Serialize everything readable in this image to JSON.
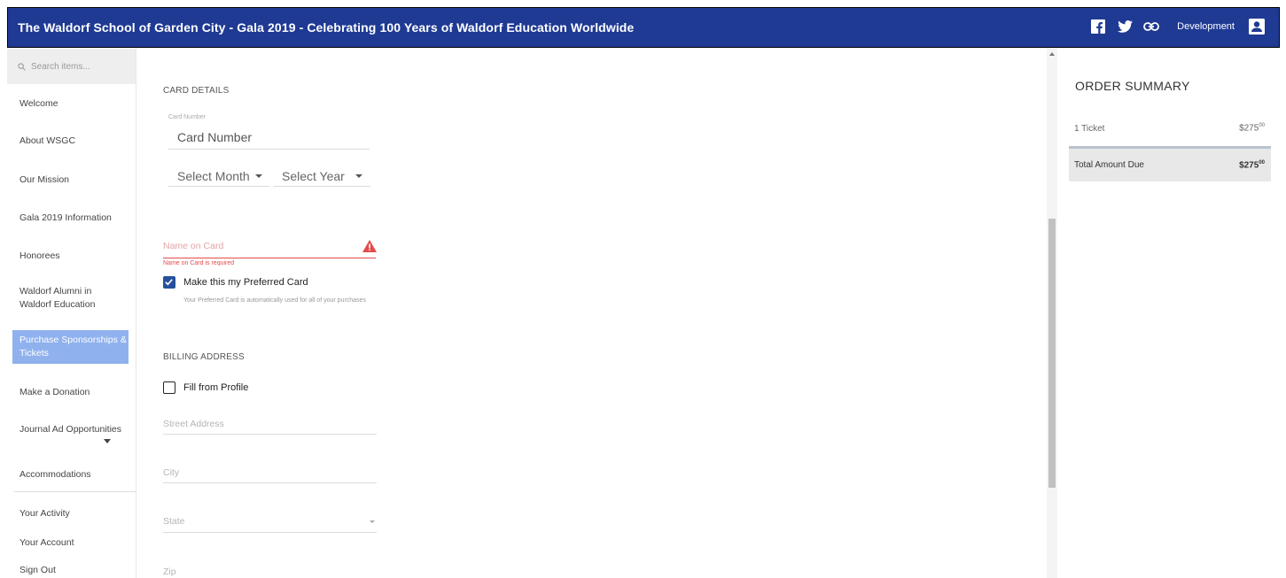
{
  "header": {
    "title": "The Waldorf School of Garden City - Gala 2019 - Celebrating 100 Years of Waldorf Education Worldwide",
    "user_label": "Development",
    "background_color": "#1f3a93"
  },
  "sidebar": {
    "search_placeholder": "Search items...",
    "items": [
      {
        "label": "Welcome"
      },
      {
        "label": "About WSGC"
      },
      {
        "label": "Our Mission"
      },
      {
        "label": "Gala 2019 Information"
      },
      {
        "label": "Honorees"
      },
      {
        "label": "Waldorf Alumni in Waldorf Education"
      },
      {
        "label": "Purchase Sponsorships & Tickets"
      },
      {
        "label": "Make a Donation"
      },
      {
        "label": "Journal Ad Opportunities"
      },
      {
        "label": "Accommodations"
      }
    ],
    "account_items": [
      {
        "label": "Your Activity"
      },
      {
        "label": "Your Account"
      },
      {
        "label": "Sign Out"
      }
    ],
    "active_color": "#8fb1ee"
  },
  "card_details": {
    "section_title": "CARD DETAILS",
    "card_number_label": "Card Number",
    "card_number_placeholder": "Card Number",
    "month_select": "Select Month",
    "year_select": "Select Year",
    "name_placeholder": "Name on Card",
    "name_error": "Name on Card is required",
    "preferred_label": "Make this my Preferred Card",
    "preferred_checked": true,
    "preferred_help": "Your Preferred Card is automatically used for all of your purchases"
  },
  "billing": {
    "section_title": "BILLING ADDRESS",
    "fill_label": "Fill from Profile",
    "fill_checked": false,
    "street_placeholder": "Street Address",
    "city_placeholder": "City",
    "state_placeholder": "State",
    "zip_placeholder": "Zip"
  },
  "order_summary": {
    "title": "ORDER SUMMARY",
    "line_label": "1 Ticket",
    "line_amount": "$275",
    "line_cents": "00",
    "total_label": "Total Amount Due",
    "total_amount": "$275",
    "total_cents": "00"
  }
}
